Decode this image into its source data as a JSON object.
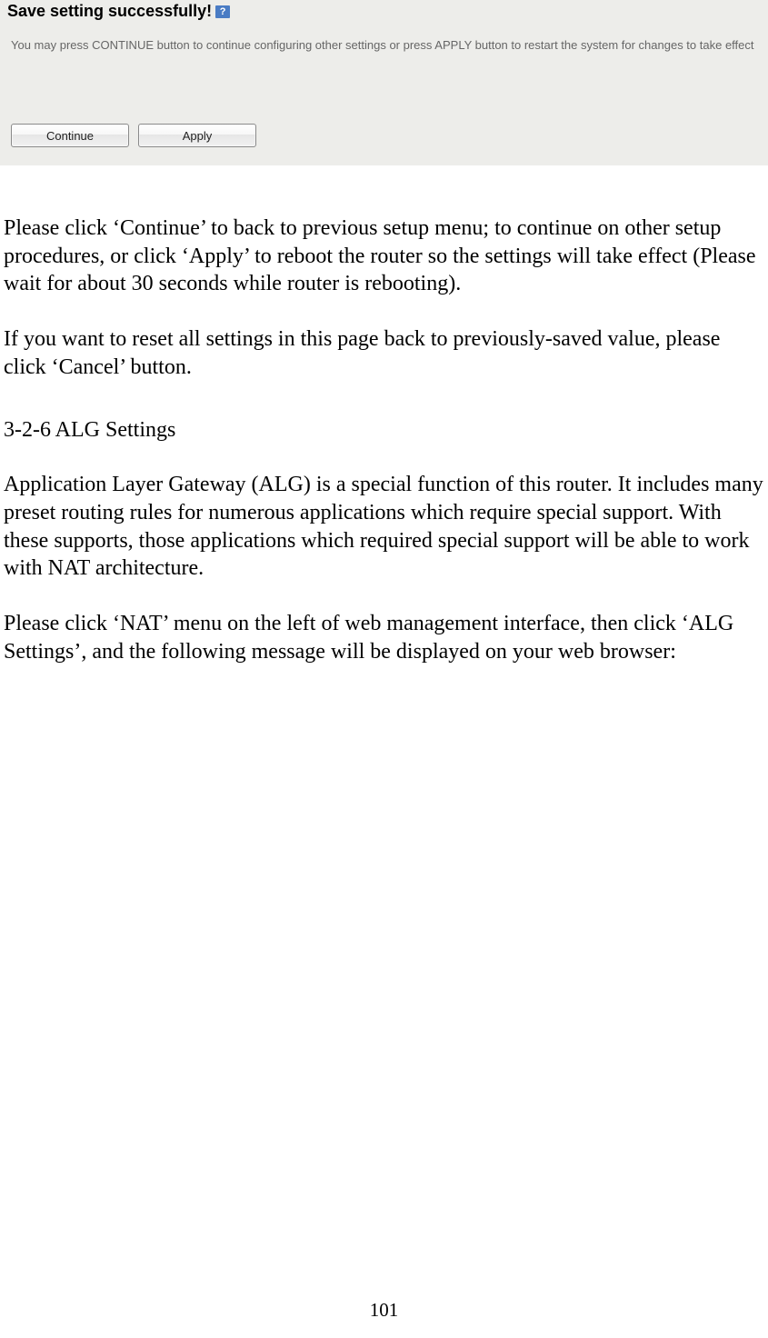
{
  "dialog": {
    "heading": "Save setting successfully!",
    "message": "You may press CONTINUE button to continue configuring other settings or press APPLY button to restart the system for changes to take effect",
    "continue_label": "Continue",
    "apply_label": "Apply",
    "question_mark": "?"
  },
  "doc": {
    "para1": "Please click ‘Continue’ to back to previous setup menu; to continue on other setup procedures, or click ‘Apply’ to reboot the router so the settings will take effect (Please wait for about 30 seconds while router is rebooting).",
    "para2": "If you want to reset all settings in this page back to previously-saved value, please click ‘Cancel’ button.",
    "heading": "3-2-6 ALG Settings",
    "para3": "Application Layer Gateway (ALG) is a special function of this router. It includes many preset routing rules for numerous applications which require special support. With these supports, those applications which required special support will be able to work with NAT architecture.",
    "para4": "Please click ‘NAT’ menu on the left of web management interface, then click ‘ALG Settings’, and the following message will be displayed on your web browser:"
  },
  "page_number": "101"
}
